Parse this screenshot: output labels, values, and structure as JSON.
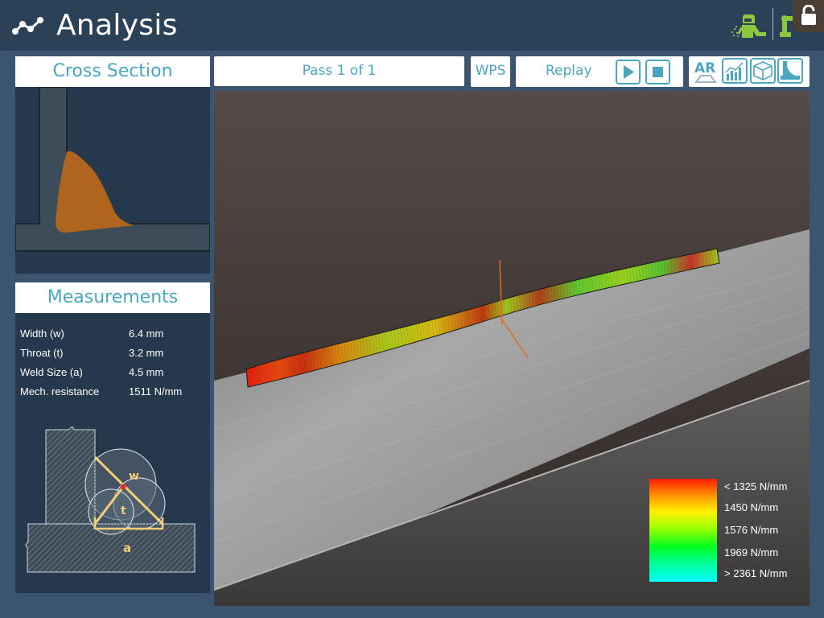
{
  "header": {
    "title": "Analysis"
  },
  "cross_section": {
    "title": "Cross Section"
  },
  "toolbar": {
    "pass_label": "Pass 1 of 1",
    "wps_label": "WPS",
    "replay_label": "Replay",
    "ar_label": "AR"
  },
  "measurements": {
    "title": "Measurements",
    "rows": [
      {
        "label": "Width (w)",
        "value": "6.4 mm"
      },
      {
        "label": "Throat (t)",
        "value": "3.2 mm"
      },
      {
        "label": "Weld Size (a)",
        "value": "4.5 mm"
      },
      {
        "label": "Mech. resistance",
        "value": "1511 N/mm"
      }
    ],
    "diagram_labels": {
      "w": "w",
      "t": "t",
      "a": "a"
    }
  },
  "legend": {
    "labels": [
      "< 1325 N/mm",
      "1450 N/mm",
      "1576 N/mm",
      "1969 N/mm",
      "> 2361 N/mm"
    ]
  },
  "colors": {
    "accent": "#4aa7c2",
    "header_bg": "#2a4157",
    "page_bg": "#3b5570",
    "panel_bg": "#26394c",
    "weld_bead": "#b0651f",
    "icon_green": "#8dc63f"
  }
}
